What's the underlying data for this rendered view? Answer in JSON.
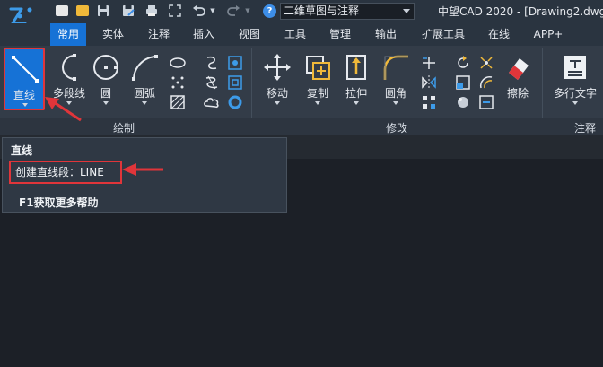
{
  "titlebar": {
    "workspace": "二维草图与注释",
    "app_title": "中望CAD 2020 - [Drawing2.dwg]"
  },
  "tabs": [
    {
      "label": "常用",
      "active": true
    },
    {
      "label": "实体"
    },
    {
      "label": "注释"
    },
    {
      "label": "插入"
    },
    {
      "label": "视图"
    },
    {
      "label": "工具"
    },
    {
      "label": "管理"
    },
    {
      "label": "输出"
    },
    {
      "label": "扩展工具"
    },
    {
      "label": "在线"
    },
    {
      "label": "APP+"
    }
  ],
  "ribbon": {
    "draw": {
      "label": "绘制",
      "line": "直线",
      "polyline": "多段线",
      "circle": "圆",
      "arc": "圆弧"
    },
    "modify": {
      "label": "修改",
      "move": "移动",
      "copy": "复制",
      "stretch": "拉伸",
      "fillet": "圆角",
      "erase": "擦除"
    },
    "annotate": {
      "label": "注释",
      "mtext": "多行文字"
    }
  },
  "tooltip": {
    "title": "直线",
    "description": "创建直线段：LINE",
    "help": "F1获取更多帮助"
  },
  "colors": {
    "accent": "#1672d6",
    "highlight": "#e0353a",
    "ribbon_bg": "#333c48",
    "titlebar_bg": "#2a3440"
  },
  "icons": [
    "app-logo-icon",
    "new-file-icon",
    "open-folder-icon",
    "save-icon",
    "save-as-icon",
    "print-icon",
    "undo-icon",
    "redo-icon",
    "help-icon",
    "line-icon",
    "polyline-icon",
    "circle-icon",
    "arc-icon",
    "move-icon",
    "copy-icon",
    "stretch-icon",
    "fillet-icon",
    "eraser-icon",
    "mtext-icon"
  ]
}
